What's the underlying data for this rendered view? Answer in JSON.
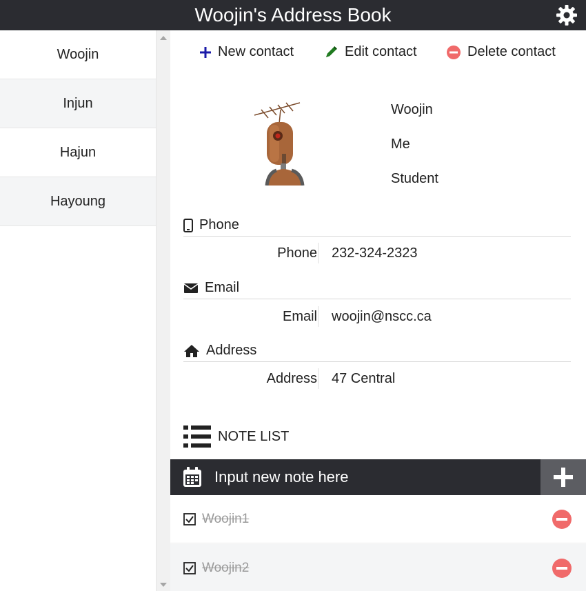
{
  "header": {
    "title": "Woojin's Address Book"
  },
  "sidebar": {
    "items": [
      {
        "label": "Woojin"
      },
      {
        "label": "Injun"
      },
      {
        "label": "Hajun"
      },
      {
        "label": "Hayoung"
      }
    ]
  },
  "toolbar": {
    "new_label": "New contact",
    "edit_label": "Edit contact",
    "delete_label": "Delete contact"
  },
  "contact": {
    "name": "Woojin",
    "relation": "Me",
    "occupation": "Student",
    "phone": {
      "heading": "Phone",
      "label": "Phone",
      "value": "232-324-2323"
    },
    "email": {
      "heading": "Email",
      "label": "Email",
      "value": "woojin@nscc.ca"
    },
    "address": {
      "heading": "Address",
      "label": "Address",
      "value": "47 Central"
    }
  },
  "notes": {
    "heading": "NOTE LIST",
    "placeholder": "Input new note here",
    "items": [
      {
        "text": "Woojin1",
        "done": true
      },
      {
        "text": "Woojin2",
        "done": true
      }
    ]
  },
  "colors": {
    "header_bg": "#2b2c31",
    "new_icon": "#1a1aa8",
    "edit_icon": "#1f7a1f",
    "delete_icon": "#f06a6a"
  },
  "icons": {
    "settings": "gear-icon",
    "new": "plus-icon",
    "edit": "pencil-icon",
    "delete": "minus-circle-icon",
    "phone": "mobile-phone-icon",
    "email": "envelope-icon",
    "address": "home-icon",
    "note_list": "list-icon",
    "note_input": "calendar-icon",
    "add_note": "plus-icon",
    "note_check": "checkbox-checked-icon",
    "note_delete": "minus-circle-icon"
  }
}
